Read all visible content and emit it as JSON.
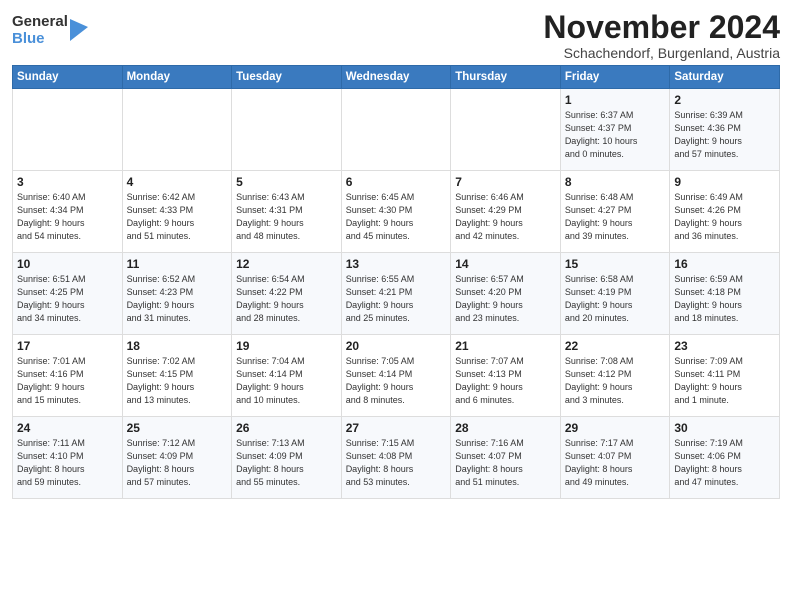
{
  "logo": {
    "general": "General",
    "blue": "Blue"
  },
  "title": "November 2024",
  "subtitle": "Schachendorf, Burgenland, Austria",
  "headers": [
    "Sunday",
    "Monday",
    "Tuesday",
    "Wednesday",
    "Thursday",
    "Friday",
    "Saturday"
  ],
  "weeks": [
    [
      {
        "day": "",
        "detail": ""
      },
      {
        "day": "",
        "detail": ""
      },
      {
        "day": "",
        "detail": ""
      },
      {
        "day": "",
        "detail": ""
      },
      {
        "day": "",
        "detail": ""
      },
      {
        "day": "1",
        "detail": "Sunrise: 6:37 AM\nSunset: 4:37 PM\nDaylight: 10 hours\nand 0 minutes."
      },
      {
        "day": "2",
        "detail": "Sunrise: 6:39 AM\nSunset: 4:36 PM\nDaylight: 9 hours\nand 57 minutes."
      }
    ],
    [
      {
        "day": "3",
        "detail": "Sunrise: 6:40 AM\nSunset: 4:34 PM\nDaylight: 9 hours\nand 54 minutes."
      },
      {
        "day": "4",
        "detail": "Sunrise: 6:42 AM\nSunset: 4:33 PM\nDaylight: 9 hours\nand 51 minutes."
      },
      {
        "day": "5",
        "detail": "Sunrise: 6:43 AM\nSunset: 4:31 PM\nDaylight: 9 hours\nand 48 minutes."
      },
      {
        "day": "6",
        "detail": "Sunrise: 6:45 AM\nSunset: 4:30 PM\nDaylight: 9 hours\nand 45 minutes."
      },
      {
        "day": "7",
        "detail": "Sunrise: 6:46 AM\nSunset: 4:29 PM\nDaylight: 9 hours\nand 42 minutes."
      },
      {
        "day": "8",
        "detail": "Sunrise: 6:48 AM\nSunset: 4:27 PM\nDaylight: 9 hours\nand 39 minutes."
      },
      {
        "day": "9",
        "detail": "Sunrise: 6:49 AM\nSunset: 4:26 PM\nDaylight: 9 hours\nand 36 minutes."
      }
    ],
    [
      {
        "day": "10",
        "detail": "Sunrise: 6:51 AM\nSunset: 4:25 PM\nDaylight: 9 hours\nand 34 minutes."
      },
      {
        "day": "11",
        "detail": "Sunrise: 6:52 AM\nSunset: 4:23 PM\nDaylight: 9 hours\nand 31 minutes."
      },
      {
        "day": "12",
        "detail": "Sunrise: 6:54 AM\nSunset: 4:22 PM\nDaylight: 9 hours\nand 28 minutes."
      },
      {
        "day": "13",
        "detail": "Sunrise: 6:55 AM\nSunset: 4:21 PM\nDaylight: 9 hours\nand 25 minutes."
      },
      {
        "day": "14",
        "detail": "Sunrise: 6:57 AM\nSunset: 4:20 PM\nDaylight: 9 hours\nand 23 minutes."
      },
      {
        "day": "15",
        "detail": "Sunrise: 6:58 AM\nSunset: 4:19 PM\nDaylight: 9 hours\nand 20 minutes."
      },
      {
        "day": "16",
        "detail": "Sunrise: 6:59 AM\nSunset: 4:18 PM\nDaylight: 9 hours\nand 18 minutes."
      }
    ],
    [
      {
        "day": "17",
        "detail": "Sunrise: 7:01 AM\nSunset: 4:16 PM\nDaylight: 9 hours\nand 15 minutes."
      },
      {
        "day": "18",
        "detail": "Sunrise: 7:02 AM\nSunset: 4:15 PM\nDaylight: 9 hours\nand 13 minutes."
      },
      {
        "day": "19",
        "detail": "Sunrise: 7:04 AM\nSunset: 4:14 PM\nDaylight: 9 hours\nand 10 minutes."
      },
      {
        "day": "20",
        "detail": "Sunrise: 7:05 AM\nSunset: 4:14 PM\nDaylight: 9 hours\nand 8 minutes."
      },
      {
        "day": "21",
        "detail": "Sunrise: 7:07 AM\nSunset: 4:13 PM\nDaylight: 9 hours\nand 6 minutes."
      },
      {
        "day": "22",
        "detail": "Sunrise: 7:08 AM\nSunset: 4:12 PM\nDaylight: 9 hours\nand 3 minutes."
      },
      {
        "day": "23",
        "detail": "Sunrise: 7:09 AM\nSunset: 4:11 PM\nDaylight: 9 hours\nand 1 minute."
      }
    ],
    [
      {
        "day": "24",
        "detail": "Sunrise: 7:11 AM\nSunset: 4:10 PM\nDaylight: 8 hours\nand 59 minutes."
      },
      {
        "day": "25",
        "detail": "Sunrise: 7:12 AM\nSunset: 4:09 PM\nDaylight: 8 hours\nand 57 minutes."
      },
      {
        "day": "26",
        "detail": "Sunrise: 7:13 AM\nSunset: 4:09 PM\nDaylight: 8 hours\nand 55 minutes."
      },
      {
        "day": "27",
        "detail": "Sunrise: 7:15 AM\nSunset: 4:08 PM\nDaylight: 8 hours\nand 53 minutes."
      },
      {
        "day": "28",
        "detail": "Sunrise: 7:16 AM\nSunset: 4:07 PM\nDaylight: 8 hours\nand 51 minutes."
      },
      {
        "day": "29",
        "detail": "Sunrise: 7:17 AM\nSunset: 4:07 PM\nDaylight: 8 hours\nand 49 minutes."
      },
      {
        "day": "30",
        "detail": "Sunrise: 7:19 AM\nSunset: 4:06 PM\nDaylight: 8 hours\nand 47 minutes."
      }
    ]
  ]
}
